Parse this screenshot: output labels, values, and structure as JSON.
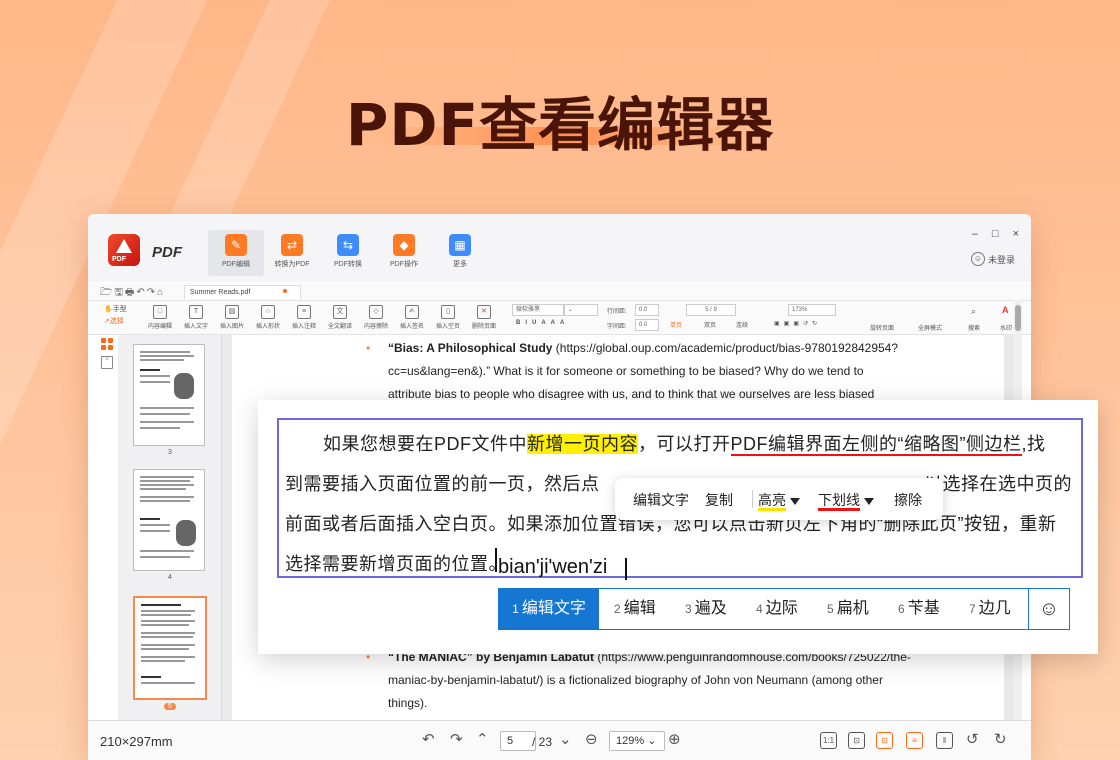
{
  "hero": {
    "title": "PDF查看编辑器"
  },
  "app": {
    "name": "PDF",
    "login": "未登录",
    "win_controls": [
      "–",
      "□",
      "×"
    ],
    "top_nav": [
      {
        "label": "PDF编辑",
        "icon": "edit-doc-icon",
        "color": "#ff7a24",
        "active": true
      },
      {
        "label": "转换为PDF",
        "icon": "convert-to-pdf-icon",
        "color": "#ff7a24"
      },
      {
        "label": "PDF转换",
        "icon": "pdf-convert-icon",
        "color": "#3f8cff"
      },
      {
        "label": "PDF操作",
        "icon": "pdf-operate-icon",
        "color": "#ff7a24"
      },
      {
        "label": "更多",
        "icon": "more-grid-icon",
        "color": "#3f8cff"
      }
    ]
  },
  "tab": {
    "filename": "Summer Reads.pdf"
  },
  "ribbon": {
    "mode_hand": "手型",
    "mode_select": "选择",
    "tools": [
      "内容编辑",
      "插入文字",
      "插入图片",
      "插入形状",
      "插入注释",
      "全文翻译",
      "内容擦除",
      "插入签名",
      "插入空页",
      "删除页面"
    ],
    "font": "微软雅黑",
    "line_spacing_label": "行间距:",
    "line_spacing": "0.0",
    "char_spacing_label": "字间距:",
    "char_spacing": "0.0",
    "page_nav": "5 / 9",
    "single": "单页",
    "double": "双页",
    "continuous": "连续",
    "zoom": "173%",
    "rotate": "旋转页面",
    "fullscreen": "全屏模式",
    "search": "搜索",
    "watermark": "水印"
  },
  "thumbnails": {
    "pages": [
      "3",
      "4",
      "5"
    ]
  },
  "doc": {
    "line1_bold": "“Bias: A Philosophical Study",
    "line1_rest": " (https://global.oup.com/academic/product/bias-9780192842954?",
    "line2": "cc=us&lang=en&).” What is it for someone or something to be biased? Why do we tend to",
    "line3": "attribute bias to people who disagree with us, and to think that we ourselves are less biased",
    "line4_bold": "“The MANIAC” by Benjamin Labatut",
    "line4_rest": " (https://www.penguinrandomhouse.com/books/725022/the-",
    "line5": "maniac-by-benjamin-labatut/) is a fictionalized biography of John von Neumann (among other",
    "line6": "things)."
  },
  "status": {
    "dimensions": "210×297mm",
    "page": "5",
    "total": "/ 23",
    "zoom": "129%"
  },
  "popout": {
    "l1_a": "如果您想要在PDF文件中",
    "l1_hl": "新增一页内容",
    "l1_b": "，可以打开",
    "l1_u": "PDF编辑界面左侧的“缩略图”侧边栏",
    "l1_c": ",找",
    "l2_a": "到需要插入页面位置的前一页，然后点",
    "l2_b": "以选择在选中页的",
    "l3": "前面或者后面插入空白页。如果添加位置错误，您可以点击新页左下角的“删除此页”按钮，重新",
    "l4": "选择需要新增页面的位置。",
    "menu": {
      "edit": "编辑文字",
      "copy": "复制",
      "highlight": "高亮",
      "underline": "下划线",
      "erase": "擦除"
    },
    "pinyin": "bian'ji'wen'zi",
    "candidates": [
      {
        "n": "1",
        "t": "编辑文字"
      },
      {
        "n": "2",
        "t": "编辑"
      },
      {
        "n": "3",
        "t": "遍及"
      },
      {
        "n": "4",
        "t": "边际"
      },
      {
        "n": "5",
        "t": "扁机"
      },
      {
        "n": "6",
        "t": "苄基"
      },
      {
        "n": "7",
        "t": "边几"
      }
    ],
    "emoji": "☺"
  }
}
